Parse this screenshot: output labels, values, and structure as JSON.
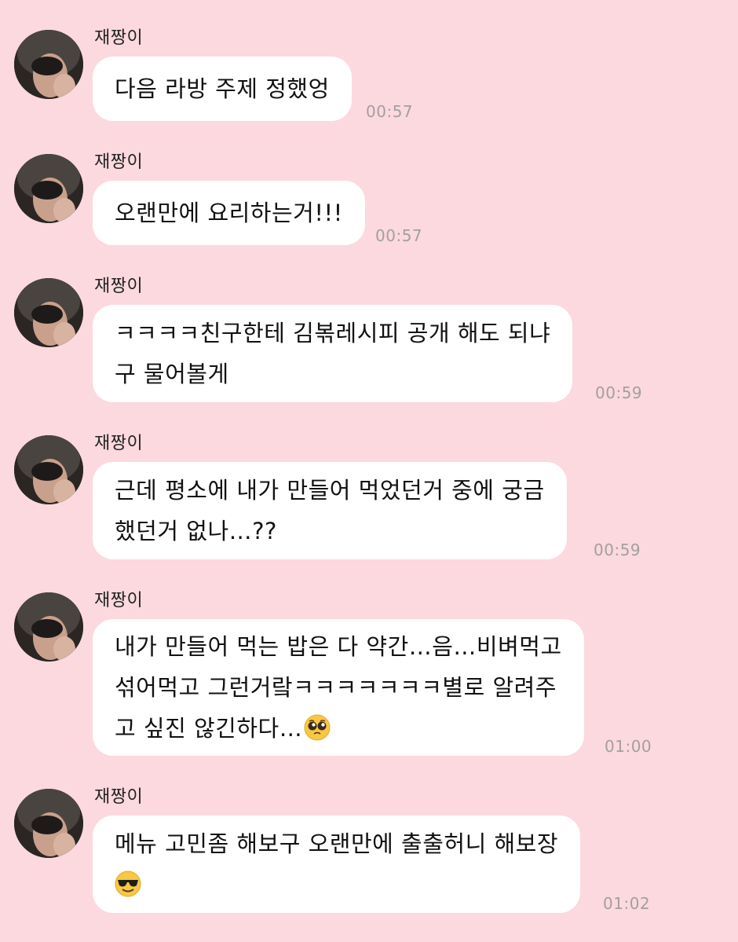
{
  "chat": {
    "messages": [
      {
        "sender": "재짱이",
        "lines": [
          "다음 라방 주제 정했엉"
        ],
        "time": "00:57"
      },
      {
        "sender": "재짱이",
        "lines": [
          "오랜만에 요리하는거!!!"
        ],
        "time": "00:57"
      },
      {
        "sender": "재짱이",
        "lines": [
          "ㅋㅋㅋㅋ친구한테 김볶레시피 공개 해도 되냐",
          "구 물어볼게"
        ],
        "time": "00:59"
      },
      {
        "sender": "재짱이",
        "lines": [
          "근데 평소에 내가 만들어 먹었던거 중에 궁금",
          "했던거 없나…??"
        ],
        "time": "00:59"
      },
      {
        "sender": "재짱이",
        "lines": [
          "내가 만들어 먹는 밥은 다 약간…음…비벼먹고",
          "섞어먹고 그런거랔ㅋㅋㅋㅋㅋㅋㅋ별로 알려주",
          "고 싶진 않긴하다…"
        ],
        "emoji5": "pleading-face-emoji",
        "time": "01:00"
      },
      {
        "sender": "재짱이",
        "lines": [
          "메뉴 고민좀 해보구 오랜만에 출출허니 해보장"
        ],
        "emoji6": "sunglasses-face-emoji",
        "time": "01:02"
      }
    ]
  },
  "colors": {
    "background": "#fbd9df",
    "bubble": "#ffffff",
    "timestamp": "#a59ea0"
  }
}
